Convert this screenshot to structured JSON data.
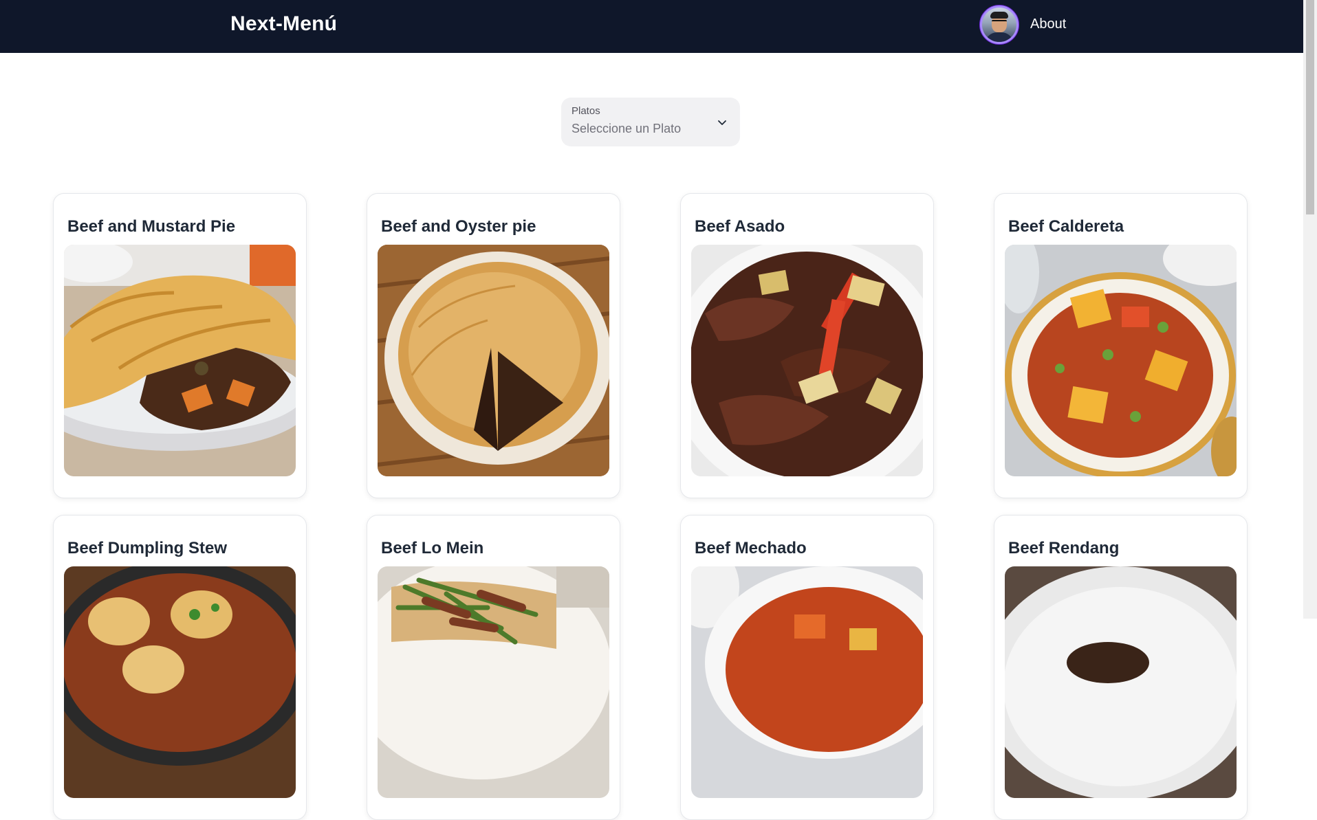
{
  "navbar": {
    "brand": "Next-Menú",
    "about_label": "About",
    "avatar_icon": "user-avatar"
  },
  "filter": {
    "label": "Platos",
    "placeholder": "Seleccione un Plato",
    "icon": "chevron-down-icon"
  },
  "dishes": [
    {
      "name": "Beef and Mustard Pie"
    },
    {
      "name": "Beef and Oyster pie"
    },
    {
      "name": "Beef Asado"
    },
    {
      "name": "Beef Caldereta"
    },
    {
      "name": "Beef Dumpling Stew"
    },
    {
      "name": "Beef Lo Mein"
    },
    {
      "name": "Beef Mechado"
    },
    {
      "name": "Beef Rendang"
    }
  ],
  "colors": {
    "navbar_bg": "#0f172a",
    "select_bg": "#f1f1f3",
    "avatar_ring": "#a78bfa"
  }
}
